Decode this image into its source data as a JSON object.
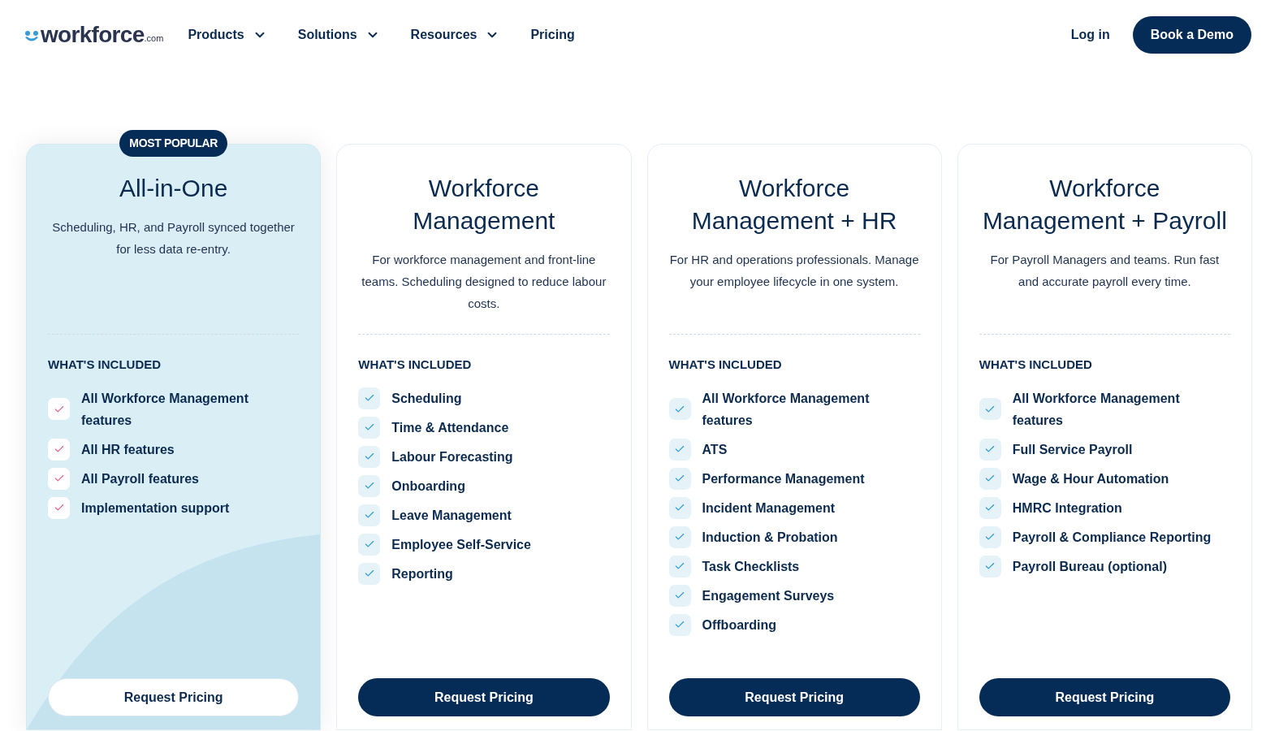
{
  "header": {
    "logo": {
      "word": "workforce",
      "suffix": ".com"
    },
    "nav": [
      {
        "label": "Products",
        "dropdown": true
      },
      {
        "label": "Solutions",
        "dropdown": true
      },
      {
        "label": "Resources",
        "dropdown": true
      },
      {
        "label": "Pricing",
        "dropdown": false
      }
    ],
    "login": "Log in",
    "cta": "Book a Demo"
  },
  "plans": [
    {
      "badge": "MOST POPULAR",
      "featured": true,
      "title": "All-in-One",
      "description": "Scheduling, HR, and Payroll synced together for less data re-entry.",
      "included_label": "WHAT'S INCLUDED",
      "features": [
        "All Workforce Management features",
        "All HR features",
        "All Payroll features",
        "Implementation support"
      ],
      "button": "Request Pricing"
    },
    {
      "featured": false,
      "title": "Workforce Management",
      "description": "For workforce management and front-line teams. Scheduling designed to reduce labour costs.",
      "included_label": "WHAT'S INCLUDED",
      "features": [
        "Scheduling",
        "Time & Attendance",
        "Labour Forecasting",
        "Onboarding",
        "Leave Management",
        "Employee Self-Service",
        "Reporting"
      ],
      "button": "Request Pricing"
    },
    {
      "featured": false,
      "title": "Workforce Management + HR",
      "description": "For HR and operations professionals. Manage your employee lifecycle in one system.",
      "included_label": "WHAT'S INCLUDED",
      "features": [
        "All Workforce Management features",
        "ATS",
        "Performance Management",
        "Incident Management",
        "Induction & Probation",
        "Task Checklists",
        "Engagement Surveys",
        "Offboarding"
      ],
      "button": "Request Pricing"
    },
    {
      "featured": false,
      "title": "Workforce Management + Payroll",
      "description": "For Payroll Managers and teams. Run fast and accurate payroll every time.",
      "included_label": "WHAT'S INCLUDED",
      "features": [
        "All Workforce Management features",
        "Full Service Payroll",
        "Wage & Hour Automation",
        "HMRC Integration",
        "Payroll & Compliance Reporting",
        "Payroll Bureau (optional)"
      ],
      "button": "Request Pricing"
    }
  ]
}
